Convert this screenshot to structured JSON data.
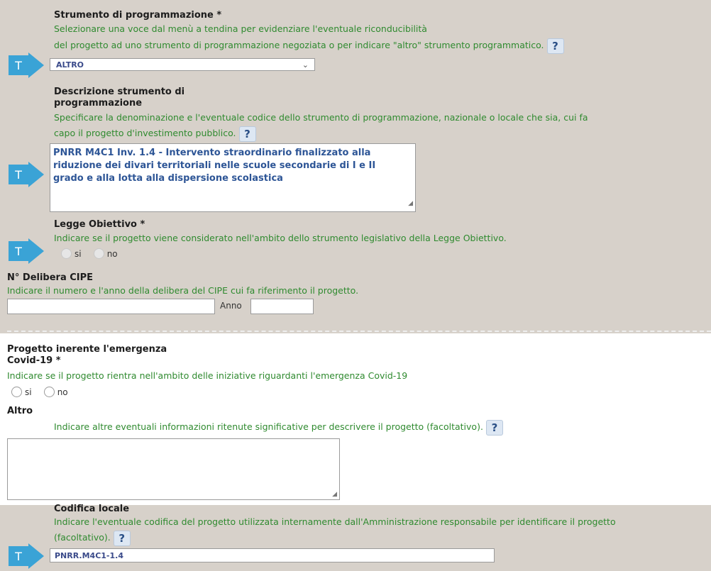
{
  "strumento": {
    "label": "Strumento di programmazione *",
    "hint1": "Selezionare una voce dal menù a tendina per evidenziare l'eventuale riconducibilità",
    "hint2": "del progetto ad uno strumento di programmazione negoziata o per indicare \"altro\" strumento programmatico.",
    "selected": "ALTRO",
    "help": "?"
  },
  "descrizione": {
    "label1": "Descrizione strumento di",
    "label2": "programmazione",
    "hint1": "Specificare la denominazione e l'eventuale codice dello strumento di programmazione, nazionale o locale che sia, cui fa",
    "hint2": "capo il progetto d'investimento pubblico.",
    "help": "?",
    "line1": "PNRR M4C1 Inv. 1.4 - Intervento straordinario finalizzato alla",
    "line2": "riduzione dei divari territoriali nelle scuole secondarie di I e II",
    "line3": "grado e alla lotta alla dispersione scolastica"
  },
  "legge": {
    "label": "Legge Obiettivo *",
    "hint": "Indicare se il progetto viene considerato nell'ambito dello strumento legislativo della Legge Obiettivo.",
    "opt_si": "si",
    "opt_no": "no"
  },
  "delibera": {
    "label": "N° Delibera CIPE",
    "hint": "Indicare il numero e l'anno della delibera del CIPE cui fa riferimento il progetto.",
    "anno_label": "Anno"
  },
  "covid": {
    "label1": "Progetto inerente l'emergenza",
    "label2": "Covid-19 *",
    "hint": "Indicare se il progetto rientra nell'ambito delle iniziative riguardanti l'emergenza Covid-19",
    "opt_si": "si",
    "opt_no": "no"
  },
  "altro": {
    "label": "Altro",
    "hint": "Indicare altre eventuali informazioni ritenute significative per descrivere il progetto (facoltativo).",
    "help": "?"
  },
  "codifica": {
    "label": "Codifica locale",
    "hint1": "Indicare l'eventuale codifica del progetto utilizzata internamente dall'Amministrazione responsabile per identificare il progetto",
    "hint2": "(facoltativo).",
    "help": "?",
    "value": "PNRR.M4C1-1.4"
  },
  "arrow_letter": "T",
  "colors": {
    "hint": "#2f8a2f",
    "arrow": "#3aa3d6",
    "background": "#d7d1ca"
  }
}
